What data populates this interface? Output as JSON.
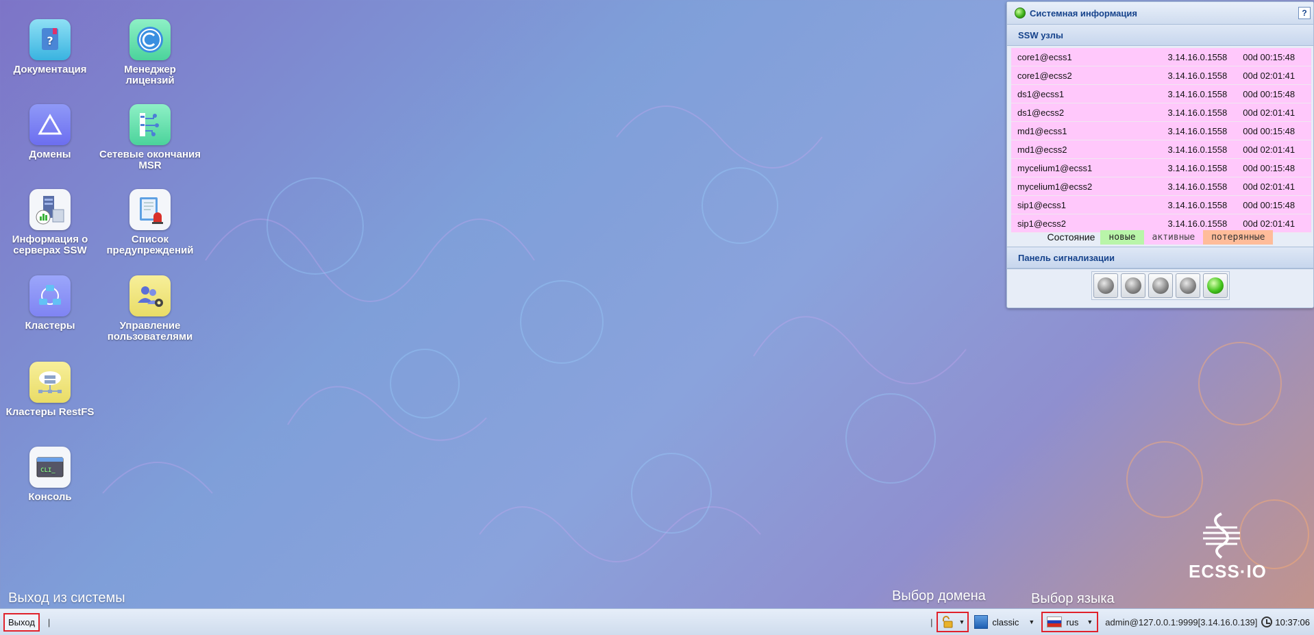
{
  "desktop": {
    "icons": [
      {
        "label": "Документация",
        "icon": "help-book-icon"
      },
      {
        "label": "Менеджер\nлицензий",
        "icon": "copyright-icon"
      },
      {
        "label": "Домены",
        "icon": "triangle-icon"
      },
      {
        "label": "Сетевые окончания\nMSR",
        "icon": "network-endpoints-icon"
      },
      {
        "label": "Информация о\nсерверах SSW",
        "icon": "server-stats-icon"
      },
      {
        "label": "Список\nпредупреждений",
        "icon": "alarm-list-icon"
      },
      {
        "label": "Кластеры",
        "icon": "cluster-icon"
      },
      {
        "label": "Управление\nпользователями",
        "icon": "user-management-icon"
      },
      {
        "label": "Кластеры RestFS",
        "icon": "cloud-storage-icon"
      },
      {
        "label": "Консоль",
        "icon": "console-icon"
      }
    ]
  },
  "sysinfo": {
    "title": "Системная информация",
    "help": "?",
    "nodes_header": "SSW узлы",
    "nodes": [
      {
        "name": "core1@ecss1",
        "version": "3.14.16.0.1558",
        "uptime": "00d 00:15:48"
      },
      {
        "name": "core1@ecss2",
        "version": "3.14.16.0.1558",
        "uptime": "00d 02:01:41"
      },
      {
        "name": "ds1@ecss1",
        "version": "3.14.16.0.1558",
        "uptime": "00d 00:15:48"
      },
      {
        "name": "ds1@ecss2",
        "version": "3.14.16.0.1558",
        "uptime": "00d 02:01:41"
      },
      {
        "name": "md1@ecss1",
        "version": "3.14.16.0.1558",
        "uptime": "00d 00:15:48"
      },
      {
        "name": "md1@ecss2",
        "version": "3.14.16.0.1558",
        "uptime": "00d 02:01:41"
      },
      {
        "name": "mycelium1@ecss1",
        "version": "3.14.16.0.1558",
        "uptime": "00d 00:15:48"
      },
      {
        "name": "mycelium1@ecss2",
        "version": "3.14.16.0.1558",
        "uptime": "00d 02:01:41"
      },
      {
        "name": "sip1@ecss1",
        "version": "3.14.16.0.1558",
        "uptime": "00d 00:15:48"
      },
      {
        "name": "sip1@ecss2",
        "version": "3.14.16.0.1558",
        "uptime": "00d 02:01:41"
      }
    ],
    "legend": {
      "label": "Состояние",
      "new": "новые",
      "active": "активные",
      "lost": "потерянные"
    },
    "alarm_header": "Панель сигнализации",
    "lamps": [
      "off",
      "off",
      "off",
      "off",
      "on"
    ]
  },
  "annotations": {
    "logout": "Выход из системы",
    "domain": "Выбор домена",
    "language": "Выбор языка"
  },
  "logo": {
    "text": "ECSS·IO"
  },
  "taskbar": {
    "logout_label": "Выход",
    "separator": "|",
    "theme": "classic",
    "language": "rus",
    "user": "admin@127.0.0.1:9999[3.14.16.0.139]",
    "time": "10:37:06"
  },
  "colors": {
    "new": "#b9f5a9",
    "active": "#ffc8fb",
    "lost": "#ffbc9a",
    "accent": "#15428b",
    "annotation_border": "#e0202a"
  }
}
